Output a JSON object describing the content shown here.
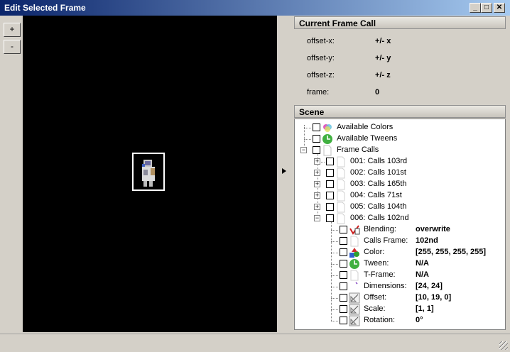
{
  "window": {
    "title": "Edit Selected Frame",
    "controls": [
      "_",
      "□",
      "✕"
    ]
  },
  "toolbar": {
    "zoom_in": "+",
    "zoom_out": "-"
  },
  "current_frame_call": {
    "title": "Current Frame Call",
    "rows": [
      {
        "label": "offset-x:",
        "value": "+/- x"
      },
      {
        "label": "offset-y:",
        "value": "+/- y"
      },
      {
        "label": "offset-z:",
        "value": "+/- z"
      },
      {
        "label": "frame:",
        "value": "0"
      }
    ]
  },
  "scene": {
    "title": "Scene",
    "top_items": [
      "Available Colors",
      "Available Tweens",
      "Frame Calls"
    ],
    "frame_calls": [
      "001: Calls 103rd",
      "002: Calls 101st",
      "003: Calls 165th",
      "004: Calls 71st",
      "005: Calls 104th",
      "006: Calls 102nd"
    ],
    "properties": [
      {
        "label": "Blending:",
        "value": "overwrite",
        "icon": "blending-icon"
      },
      {
        "label": "Calls Frame:",
        "value": "102nd",
        "icon": "page-icon"
      },
      {
        "label": "Color:",
        "value": "[255, 255, 255, 255]",
        "icon": "color-shapes-icon"
      },
      {
        "label": "Tween:",
        "value": "N/A",
        "icon": "tween-clock-icon"
      },
      {
        "label": "T-Frame:",
        "value": "N/A",
        "icon": "page-icon"
      },
      {
        "label": "Dimensions:",
        "value": "[24, 24]",
        "icon": "dimensions-icon"
      },
      {
        "label": "Offset:",
        "value": "[10, 19, 0]",
        "icon": "drafting-icon"
      },
      {
        "label": "Scale:",
        "value": "[1, 1]",
        "icon": "drafting-icon"
      },
      {
        "label": "Rotation:",
        "value": "0°",
        "icon": "drafting-icon"
      }
    ]
  },
  "colors": {
    "title_bar_start": "#0a246a",
    "title_bar_end": "#a6caf0",
    "canvas": "#000000",
    "chrome": "#d4d0c8"
  }
}
